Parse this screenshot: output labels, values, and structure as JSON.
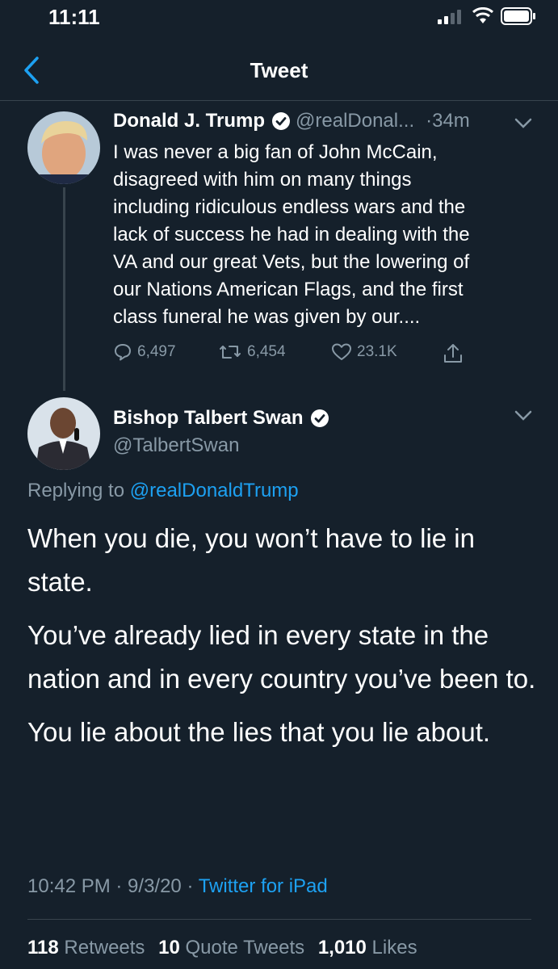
{
  "status_bar": {
    "time": "11:11"
  },
  "nav": {
    "title": "Tweet"
  },
  "parent_tweet": {
    "name": "Donald J. Trump",
    "handle": "@realDonal...",
    "time": "·34m",
    "text": "I was never a big fan of John McCain,\ndisagreed with him on many things\nincluding ridiculous endless wars and the\nlack of success he had in dealing with the\nVA and our great Vets, but the lowering of\nour Nations American Flags, and the first\nclass funeral he was given by our....",
    "replies": "6,497",
    "retweets": "6,454",
    "likes": "23.1K"
  },
  "reply_tweet": {
    "name": "Bishop Talbert Swan",
    "handle": "@TalbertSwan",
    "replying_prefix": "Replying to",
    "replying_to": "@realDonaldTrump",
    "paragraphs": [
      "When you die, you won’t have to lie in state.",
      "You’ve already lied in every state in the nation and in every country you’ve been to.",
      "You lie about the lies that you lie about."
    ],
    "timestamp": "10:42 PM · 9/3/20 ·",
    "source": "Twitter for iPad",
    "retweet_count": "118",
    "retweet_label": "Retweets",
    "quote_count": "10",
    "quote_label": "Quote Tweets",
    "like_count": "1,010",
    "like_label": "Likes"
  },
  "colors": {
    "background": "#15202b",
    "accent": "#1da1f2",
    "muted": "#8899a6",
    "divider": "#38444d"
  }
}
